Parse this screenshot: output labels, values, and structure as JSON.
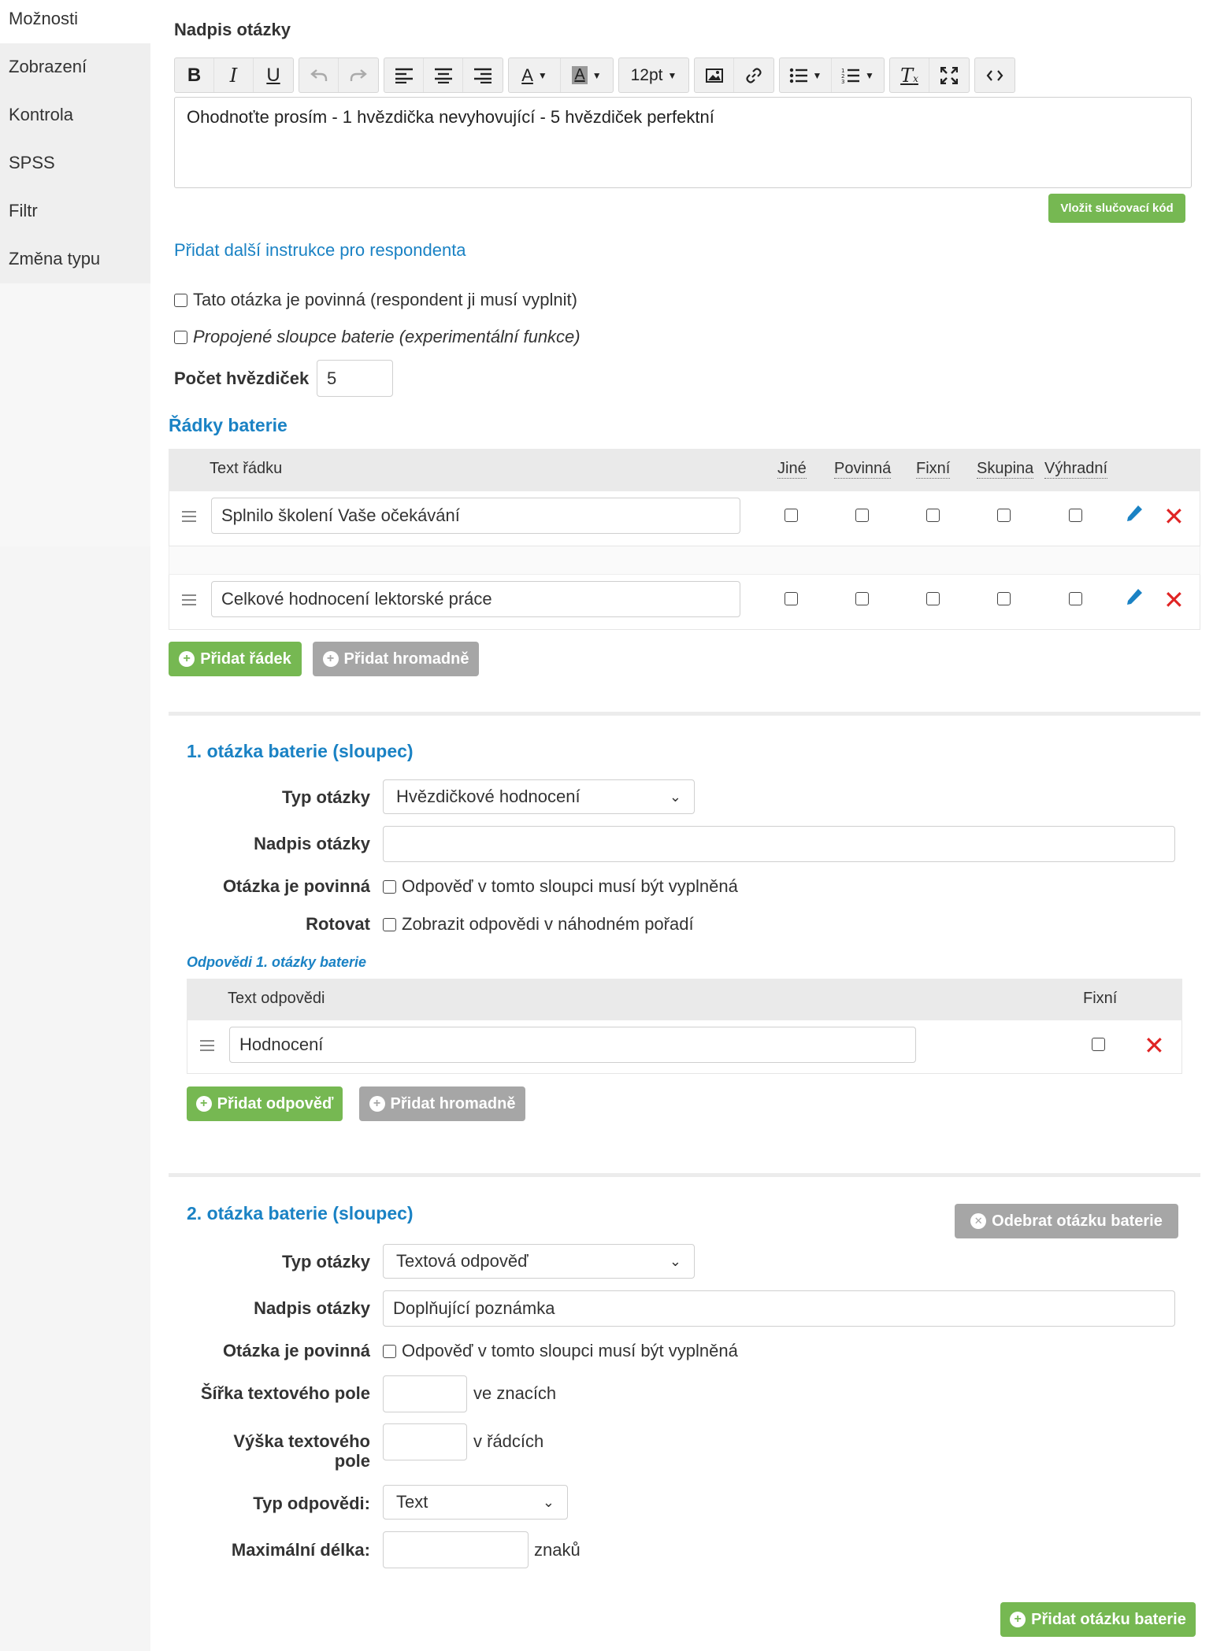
{
  "sidebar": {
    "items": [
      {
        "label": "Možnosti"
      },
      {
        "label": "Zobrazení"
      },
      {
        "label": "Kontrola"
      },
      {
        "label": "SPSS"
      },
      {
        "label": "Filtr"
      },
      {
        "label": "Změna typu"
      }
    ]
  },
  "question": {
    "title_label": "Nadpis otázky",
    "font_size": "12pt",
    "text": "Ohodnoťte prosím - 1 hvězdička nevyhovující - 5 hvězdiček perfektní",
    "merge_code_label": "Vložit slučovací kód",
    "add_instructions_link": "Přidat další instrukce pro respondenta",
    "required_label": "Tato otázka je povinná (respondent ji musí vyplnit)",
    "linked_columns_label": "Propojené sloupce baterie (experimentální funkce)",
    "stars_count_label": "Počet hvězdiček",
    "stars_count_value": "5"
  },
  "rows_section": {
    "title": "Řádky baterie",
    "headers": {
      "text": "Text řádku",
      "other": "Jiné",
      "required": "Povinná",
      "fixed": "Fixní",
      "group": "Skupina",
      "exclusive": "Výhradní"
    },
    "rows": [
      {
        "text": "Splnilo školení Vaše očekávání"
      },
      {
        "text": "Celkové hodnocení lektorské práce"
      }
    ],
    "add_row_label": "Přidat řádek",
    "add_bulk_label": "Přidat hromadně"
  },
  "column1": {
    "title": "1. otázka baterie (sloupec)",
    "type_label": "Typ otázky",
    "type_value": "Hvězdičkové hodnocení",
    "heading_label": "Nadpis otázky",
    "heading_value": "",
    "required_label": "Otázka je povinná",
    "required_text": "Odpověď v tomto sloupci musí být vyplněná",
    "rotate_label": "Rotovat",
    "rotate_text": "Zobrazit odpovědi v náhodném pořadí",
    "answers_title": "Odpovědi 1. otázky baterie",
    "answers_header_text": "Text odpovědi",
    "answers_header_fixed": "Fixní",
    "answers": [
      {
        "text": "Hodnocení"
      }
    ],
    "add_answer_label": "Přidat odpověď",
    "add_bulk_label": "Přidat hromadně"
  },
  "column2": {
    "title": "2. otázka baterie (sloupec)",
    "remove_label": "Odebrat otázku baterie",
    "type_label": "Typ otázky",
    "type_value": "Textová odpověď",
    "heading_label": "Nadpis otázky",
    "heading_value": "Doplňující poznámka",
    "required_label": "Otázka je povinná",
    "required_text": "Odpověď v tomto sloupci musí být vyplněná",
    "width_label": "Šířka textového pole",
    "width_unit": "ve znacích",
    "height_label_1": "Výška textového",
    "height_label_2": "pole",
    "height_unit": "v řádcích",
    "answer_type_label": "Typ odpovědi:",
    "answer_type_value": "Text",
    "max_length_label": "Maximální délka:",
    "max_length_unit": "znaků"
  },
  "add_battery_question_label": "Přidat otázku baterie",
  "colors": {
    "accent_blue": "#1a82c4",
    "green": "#76b852",
    "gray": "#a6a6a6",
    "delete_red": "#e02424"
  }
}
